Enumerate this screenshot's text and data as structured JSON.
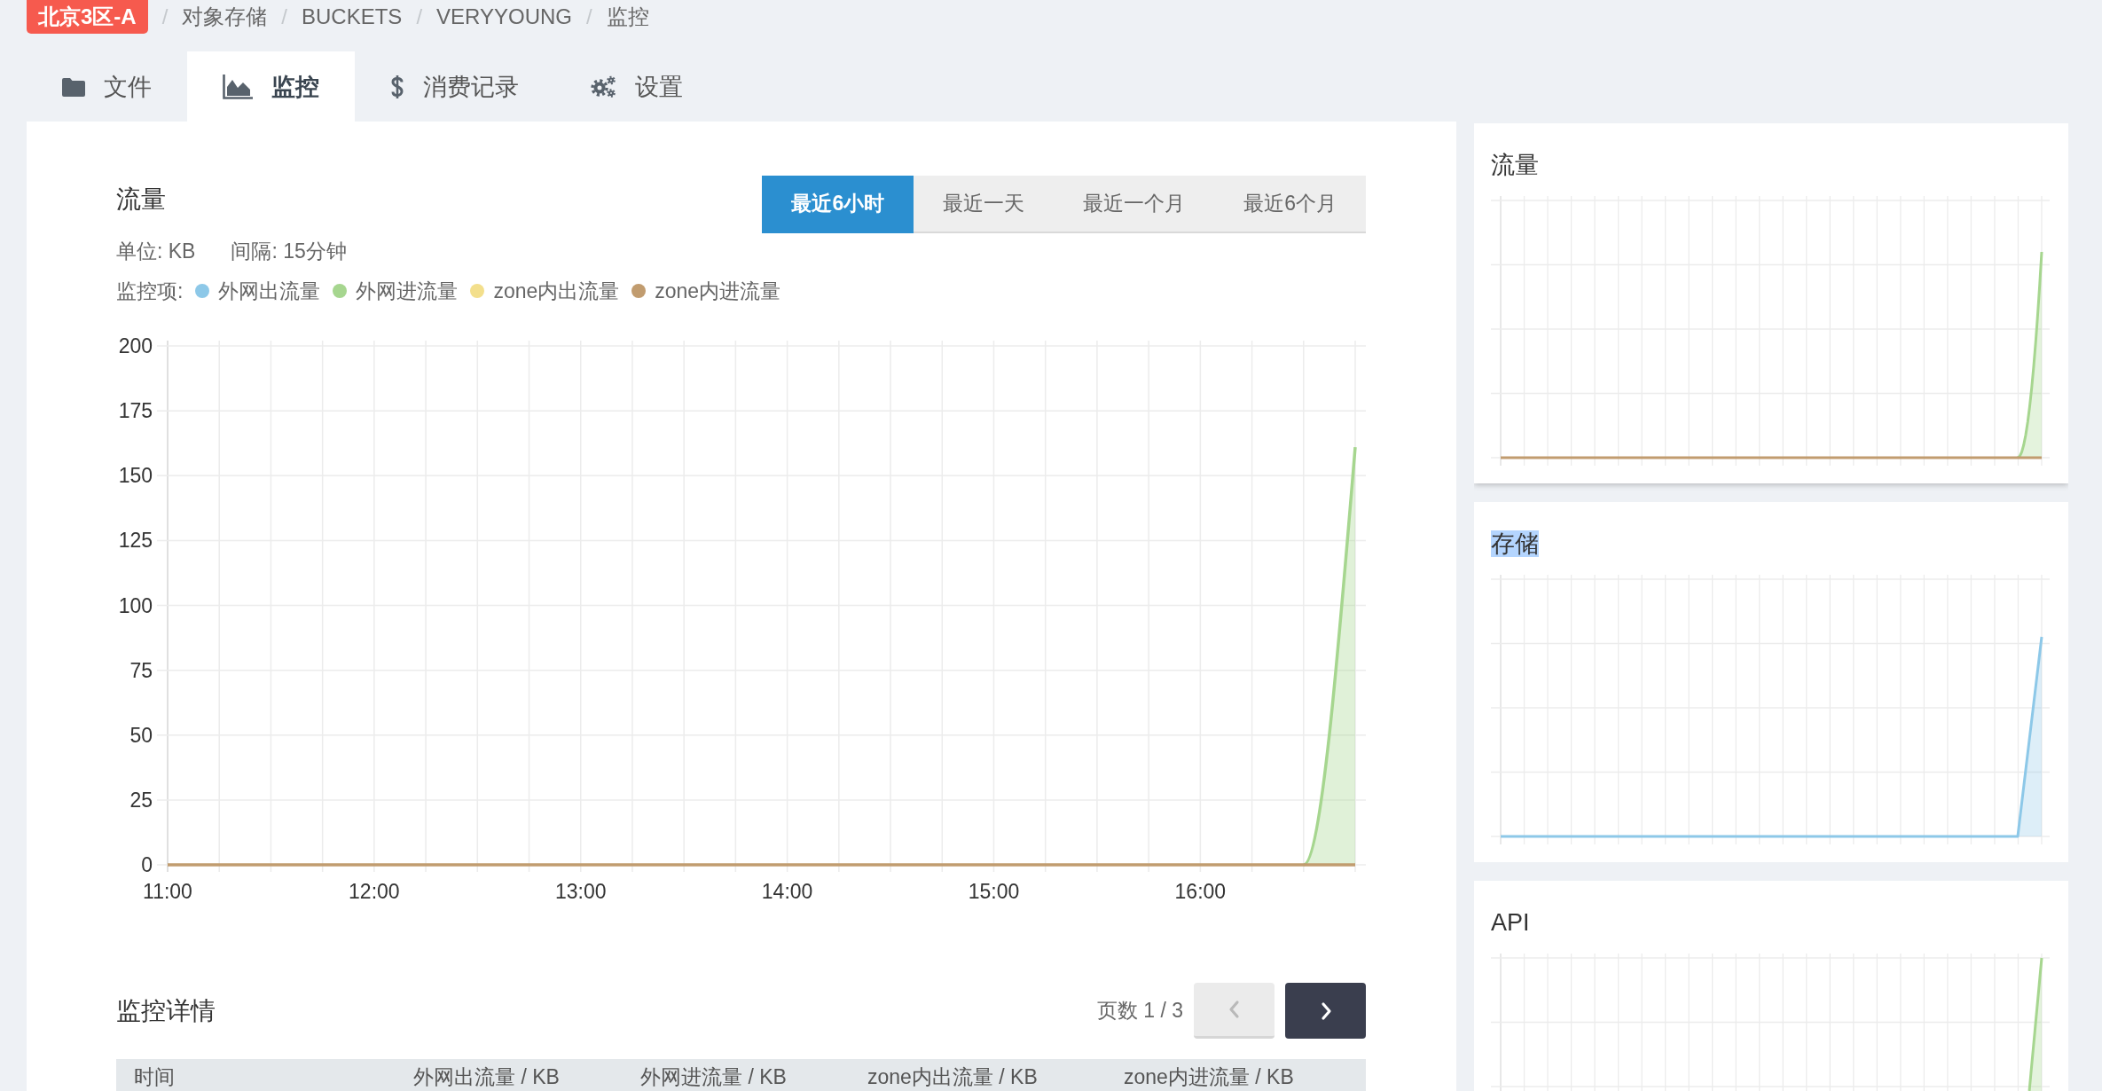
{
  "breadcrumb": {
    "region": "北京3区-A",
    "separator": "/",
    "items": [
      "对象存储",
      "BUCKETS",
      "VERYYOUNG",
      "监控"
    ]
  },
  "tabs": [
    {
      "label": "文件",
      "selected": false
    },
    {
      "label": "监控",
      "selected": true
    },
    {
      "label": "消费记录",
      "selected": false
    },
    {
      "label": "设置",
      "selected": false
    }
  ],
  "traffic": {
    "title": "流量",
    "ranges": [
      {
        "label": "最近6小时",
        "selected": true
      },
      {
        "label": "最近一天",
        "selected": false
      },
      {
        "label": "最近一个月",
        "selected": false
      },
      {
        "label": "最近6个月",
        "selected": false
      }
    ],
    "unit": "单位: KB",
    "interval": "间隔: 15分钟",
    "legend_label": "监控项:",
    "chart_data": {
      "type": "line",
      "grid": true,
      "x": [
        11,
        11.25,
        11.5,
        11.75,
        12,
        12.25,
        12.5,
        12.75,
        13,
        13.25,
        13.5,
        13.75,
        14,
        14.25,
        14.5,
        14.75,
        15,
        15.25,
        15.5,
        15.75,
        16,
        16.25,
        16.5,
        16.75
      ],
      "xlim": [
        11,
        16.75
      ],
      "ylim": [
        0,
        200
      ],
      "xticks": [
        {
          "value": 11,
          "label": "11:00"
        },
        {
          "value": 12,
          "label": "12:00"
        },
        {
          "value": 13,
          "label": "13:00"
        },
        {
          "value": 14,
          "label": "14:00"
        },
        {
          "value": 15,
          "label": "15:00"
        },
        {
          "value": 16,
          "label": "16:00"
        }
      ],
      "yticks": [
        0,
        25,
        50,
        75,
        100,
        125,
        150,
        175,
        200
      ],
      "series": [
        {
          "name": "外网出流量",
          "color": "#8dc8e8",
          "values": [
            null,
            null,
            null,
            null,
            null,
            null,
            null,
            null,
            null,
            null,
            null,
            null,
            null,
            null,
            null,
            null,
            null,
            null,
            null,
            null,
            null,
            null,
            null,
            null
          ]
        },
        {
          "name": "外网进流量",
          "color": "#a6d68f",
          "values": [
            null,
            null,
            null,
            null,
            null,
            null,
            null,
            null,
            null,
            null,
            null,
            null,
            null,
            null,
            null,
            null,
            null,
            null,
            null,
            null,
            null,
            null,
            0,
            161
          ]
        },
        {
          "name": "zone内出流量",
          "color": "#f3df8c",
          "values": [
            null,
            null,
            null,
            null,
            null,
            null,
            null,
            null,
            null,
            null,
            null,
            null,
            null,
            null,
            null,
            null,
            null,
            null,
            null,
            null,
            null,
            null,
            null,
            null
          ]
        },
        {
          "name": "zone内进流量",
          "color": "#c19c6f",
          "values": [
            0,
            0,
            0,
            0,
            0,
            0,
            0,
            0,
            0,
            0,
            0,
            0,
            0,
            0,
            0,
            0,
            0,
            0,
            0,
            0,
            0,
            0,
            0,
            0
          ]
        }
      ]
    }
  },
  "details": {
    "title": "监控详情",
    "page": "页数 1 / 3",
    "buttons": [
      {
        "kind": "prev",
        "disabled": true
      },
      {
        "kind": "next",
        "disabled": false
      }
    ],
    "table": {
      "columns": [
        "时间",
        "外网出流量 / KB",
        "外网进流量 / KB",
        "zone内出流量 / KB",
        "zone内进流量 / KB"
      ]
    }
  },
  "side_panels": [
    {
      "title": "流量",
      "kind": "traffic",
      "selected": true,
      "highlighted": false
    },
    {
      "title": "存储",
      "kind": "storage",
      "selected": false,
      "highlighted": true
    },
    {
      "title": "API",
      "kind": "api",
      "selected": false,
      "highlighted": false
    }
  ]
}
